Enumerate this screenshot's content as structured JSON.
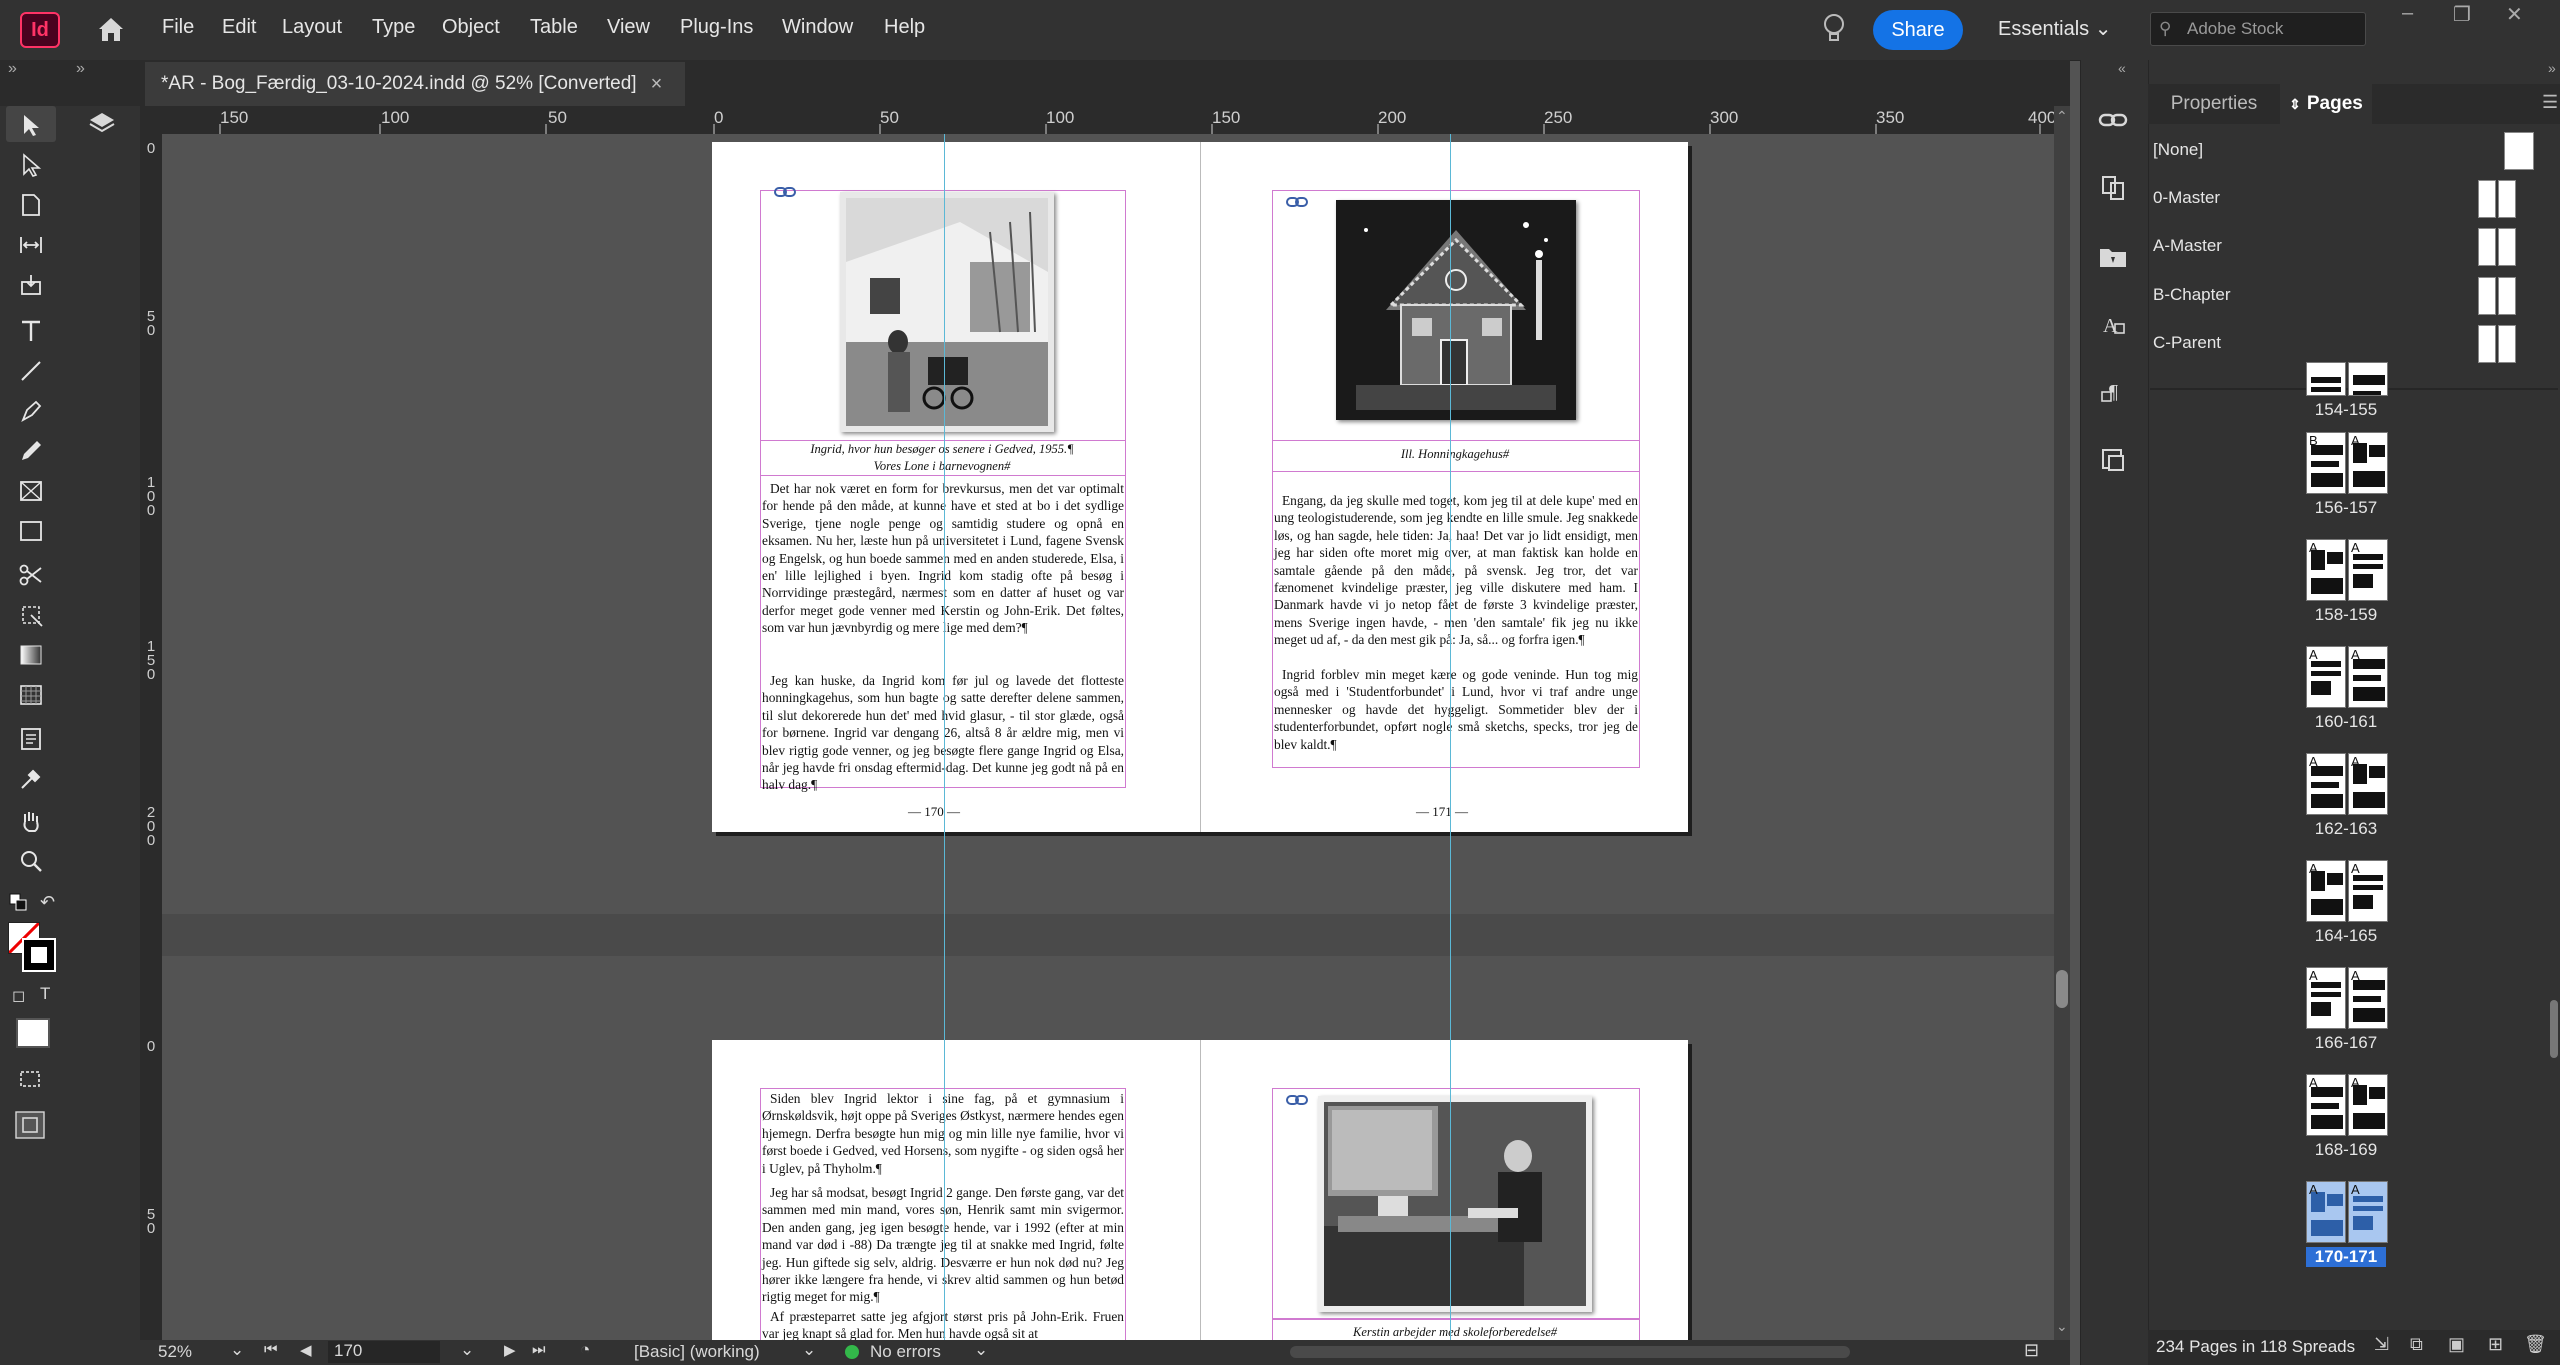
{
  "app": {
    "logo": "Id"
  },
  "menu": [
    "File",
    "Edit",
    "Layout",
    "Type",
    "Object",
    "Table",
    "View",
    "Plug-Ins",
    "Window",
    "Help"
  ],
  "header": {
    "share_label": "Share",
    "workspace": "Essentials",
    "search_placeholder": "Adobe Stock"
  },
  "document_tab": {
    "title": "*AR - Bog_Færdig_03-10-2024.indd @ 52% [Converted]",
    "close": "×"
  },
  "ruler": {
    "h_ticks": [
      "150",
      "100",
      "50",
      "0",
      "50",
      "100",
      "150",
      "200",
      "250",
      "300",
      "350",
      "400"
    ],
    "v_ticks_top": [
      "0",
      "5\n0",
      "1\n0\n0",
      "1\n5\n0",
      "2\n0\n0"
    ],
    "v_ticks_bottom": [
      "0",
      "5\n0"
    ]
  },
  "spread1": {
    "left": {
      "caption_line1": "Ingrid, hvor hun besøger os senere i Gedved, 1955.¶",
      "caption_line2": "Vores Lone i barnevognen#",
      "para1": "Det har nok været en form for brevkursus, men det var optimalt for hende på den måde, at kunne have et sted at bo i det sydlige Sverige, tjene nogle penge og samtidig studere og opnå en eksamen. Nu her, læste hun på universitetet i Lund, fagene Svensk og Engelsk, og hun boede sammen med en anden studerede, Elsa, i en' lille lejlighed i byen. Ingrid kom stadig ofte på besøg i Norrvidinge præstegård, nærmest som en datter af huset og var derfor meget gode venner med Kerstin og John-Erik. Det føltes, som var hun jævnbyrdig og mere lige med dem?¶",
      "para2": "Jeg kan huske, da Ingrid kom før jul og lavede det flotteste honningkagehus, som hun bagte og satte derefter delene sammen, til slut dekorerede hun det' med hvid glasur, - til stor glæde, også for børnene. Ingrid var dengang 26, altså 8 år ældre mig, men vi blev rigtig gode venner, og jeg besøgte flere gange Ingrid og Elsa, når jeg havde fri onsdag eftermid-dag. Det kunne jeg godt nå på en halv dag.¶",
      "folio": "— 170 —"
    },
    "right": {
      "caption": "Ill. Honningkagehus#",
      "para1": "Engang, da jeg skulle med toget, kom jeg til at dele kupe' med en ung teologistuderende, som jeg kendte en lille smule. Jeg snakkede løs, og han sagde, hele tiden: Ja, haa! Det var jo lidt ensidigt, men jeg har siden ofte moret mig over, at man faktisk kan holde en samtale gående på den måde, på svensk. Jeg tror, det var fænomenet kvindelige præster, jeg ville diskutere med ham. I Danmark havde vi jo netop fået de første 3 kvindelige præster, mens Sverige ingen havde, - men 'den samtale' fik jeg nu ikke meget ud af, - da den mest gik på: Ja, så... og forfra igen.¶",
      "para2": "Ingrid forblev min meget kære og gode veninde. Hun tog mig også med i 'Studentforbundet' i Lund, hvor vi traf andre unge mennesker og havde det hyggeligt. Sommetider blev der i studenterforbundet, opført nogle små sketchs, specks, tror jeg de blev kaldt.¶",
      "folio": "— 171 —"
    }
  },
  "spread2": {
    "left": {
      "para1": "Siden blev Ingrid lektor i sine fag, på et gymnasium i Ørnskøldsvik, højt oppe på Sveriges Østkyst, nærmere hendes egen hjemegn. Derfra besøgte hun mig og min lille nye familie, hvor vi først boede i Gedved, ved Horsens, som nygifte - og siden også her i Uglev, på Thyholm.¶",
      "para2": "Jeg har så modsat, besøgt Ingrid 2 gange. Den første gang, var det sammen med min mand, vores søn, Henrik samt min svigermor. Den anden gang, jeg igen besøgte hende, var i 1992 (efter at min mand var død i -88) Da trængte jeg til at snakke med Ingrid, følte jeg. Hun giftede sig selv, aldrig. Desværre er hun nok død nu? Jeg hører ikke længere fra hende, vi skrev altid sammen og hun betød rigtig meget for mig.¶",
      "para3": "Af præsteparret satte jeg afgjort størst pris på John-Erik. Fruen var jeg knapt så glad for. Men hun havde også sit at"
    },
    "right": {
      "caption": "Kerstin arbejder med skoleforberedelse#"
    }
  },
  "pages_panel": {
    "tabs": [
      "Properties",
      "Pages"
    ],
    "masters": [
      "[None]",
      "0-Master",
      "A-Master",
      "B-Chapter",
      "C-Parent"
    ],
    "spreads": [
      "154-155",
      "156-157",
      "158-159",
      "160-161",
      "162-163",
      "164-165",
      "166-167",
      "168-169",
      "170-171"
    ],
    "spread_letters": [
      [
        "",
        ""
      ],
      [
        "B",
        "A"
      ],
      [
        "A",
        "A"
      ],
      [
        "A",
        "A"
      ],
      [
        "A",
        "A"
      ],
      [
        "A",
        "A"
      ],
      [
        "A",
        "A"
      ],
      [
        "A",
        "A"
      ],
      [
        "A",
        "A"
      ]
    ],
    "selected_spread": "170-171",
    "footer": "234 Pages in 118 Spreads"
  },
  "status": {
    "zoom": "52%",
    "page": "170",
    "style": "[Basic] (working)",
    "errors": "No errors"
  },
  "colors": {
    "accent": "#1473e6",
    "frame": "#d07ad0",
    "guide": "#5bb8d6",
    "selection": "#2d6fd6"
  }
}
